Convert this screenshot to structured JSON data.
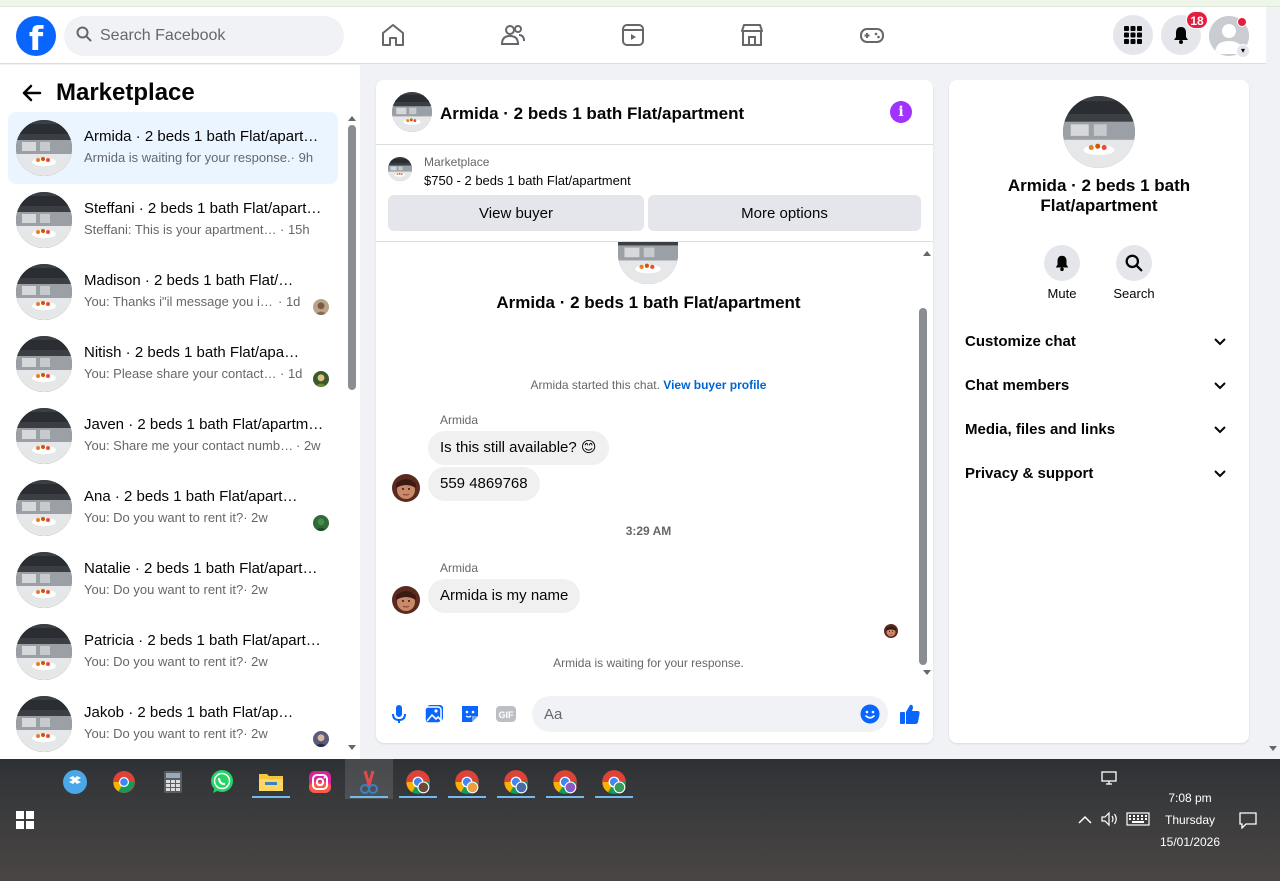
{
  "topnav": {
    "search_placeholder": "Search Facebook",
    "notification_count": "18",
    "logo_letter": "f"
  },
  "sidebar": {
    "title": "Marketplace",
    "conversations": [
      {
        "name": "Armida · 2 beds 1 bath Flat/apartment",
        "preview": "Armida is waiting for your response.",
        "time": "· 9h",
        "active": true
      },
      {
        "name": "Steffani · 2 beds 1 bath Flat/apartment",
        "preview": "Steffani: This is your apartment sti...",
        "time": "· 15h"
      },
      {
        "name": "Madison · 2 beds 1 bath Flat/apartment",
        "preview": "You: Thanks i\"il message you in ...",
        "time": "· 1d"
      },
      {
        "name": "Nitish · 2 beds 1 bath Flat/apartment",
        "preview": "You: Please share your contact n...",
        "time": "· 1d"
      },
      {
        "name": "Javen · 2 beds 1 bath Flat/apartment",
        "preview": "You: Share me your contact numbe...",
        "time": "· 2w"
      },
      {
        "name": "Ana · 2 beds 1 bath Flat/apartment",
        "preview": "You: Do you want to rent it?",
        "time": "· 2w"
      },
      {
        "name": "Natalie · 2 beds 1 bath Flat/apartment",
        "preview": "You: Do you want to rent it?",
        "time": "· 2w"
      },
      {
        "name": "Patricia · 2 beds 1 bath Flat/apartment",
        "preview": "You: Do you want to rent it?",
        "time": "· 2w"
      },
      {
        "name": "Jakob · 2 beds 1 bath Flat/apartment",
        "preview": "You: Do you want to rent it?",
        "time": "· 2w"
      }
    ]
  },
  "chat": {
    "header_title": "Armida · 2 beds 1 bath Flat/apartment",
    "listing": {
      "label": "Marketplace",
      "price_title": "$750 - 2 beds 1 bath Flat/apartment",
      "view_buyer": "View buyer",
      "more_options": "More options"
    },
    "intro_title": "Armida · 2 beds 1 bath Flat/apartment",
    "started_text": "Armida started this chat.",
    "view_buyer_profile": "View buyer profile",
    "messages": [
      {
        "sender": "Armida",
        "text": "Is this still available? 😊"
      },
      {
        "text": "559 4869768"
      },
      {
        "timestamp": "3:29 AM"
      },
      {
        "sender": "Armida",
        "text": "Armida is my name"
      }
    ],
    "waiting_text": "Armida is waiting for your response.",
    "composer_placeholder": "Aa",
    "gif_label": "GIF"
  },
  "info_panel": {
    "name": "Armida · 2 beds 1 bath Flat/apartment",
    "mute": "Mute",
    "search": "Search",
    "sections": [
      "Customize chat",
      "Chat members",
      "Media, files and links",
      "Privacy & support"
    ]
  },
  "taskbar": {
    "time": "7:08 pm",
    "day": "Thursday",
    "date": "15/01/2026"
  },
  "colors": {
    "brand_blue": "#0866ff",
    "link_blue": "#0064d1",
    "badge_red": "#e41e3f",
    "info_purple": "#a033ff",
    "active_row": "#ebf5ff"
  }
}
